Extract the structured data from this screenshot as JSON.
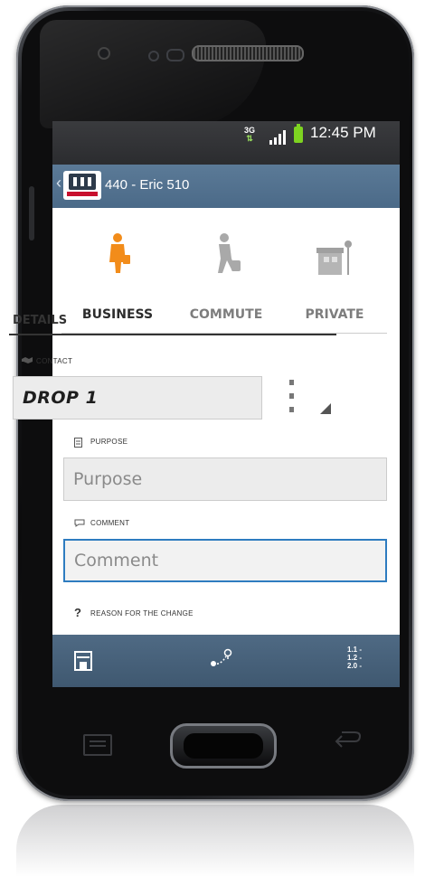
{
  "status_bar": {
    "network": "3G",
    "time": "12:45 PM"
  },
  "action_bar": {
    "title": "440 - Eric 510"
  },
  "tabs": [
    {
      "label": "BUSINESS",
      "icon": "businessman-icon",
      "selected": true
    },
    {
      "label": "COMMUTE",
      "icon": "commuter-icon",
      "selected": false
    },
    {
      "label": "PRIVATE",
      "icon": "house-icon",
      "selected": false
    }
  ],
  "details": {
    "heading": "DETAILS",
    "contact": {
      "label": "CONTACT",
      "value": "DROP 1"
    },
    "purpose": {
      "label": "PURPOSE",
      "placeholder": "Purpose"
    },
    "comment": {
      "label": "COMMENT",
      "placeholder": "Comment"
    },
    "reason": {
      "label": "REASON FOR THE CHANGE"
    }
  },
  "bottom_bar": {
    "save_icon": "save-icon",
    "route_icon": "route-icon",
    "list_label": "1.1 -\n1.2 -\n2.0 -"
  },
  "colors": {
    "action_bar": "#4b6a88",
    "accent_orange": "#f28c1a",
    "focus_blue": "#2e7cc0"
  }
}
